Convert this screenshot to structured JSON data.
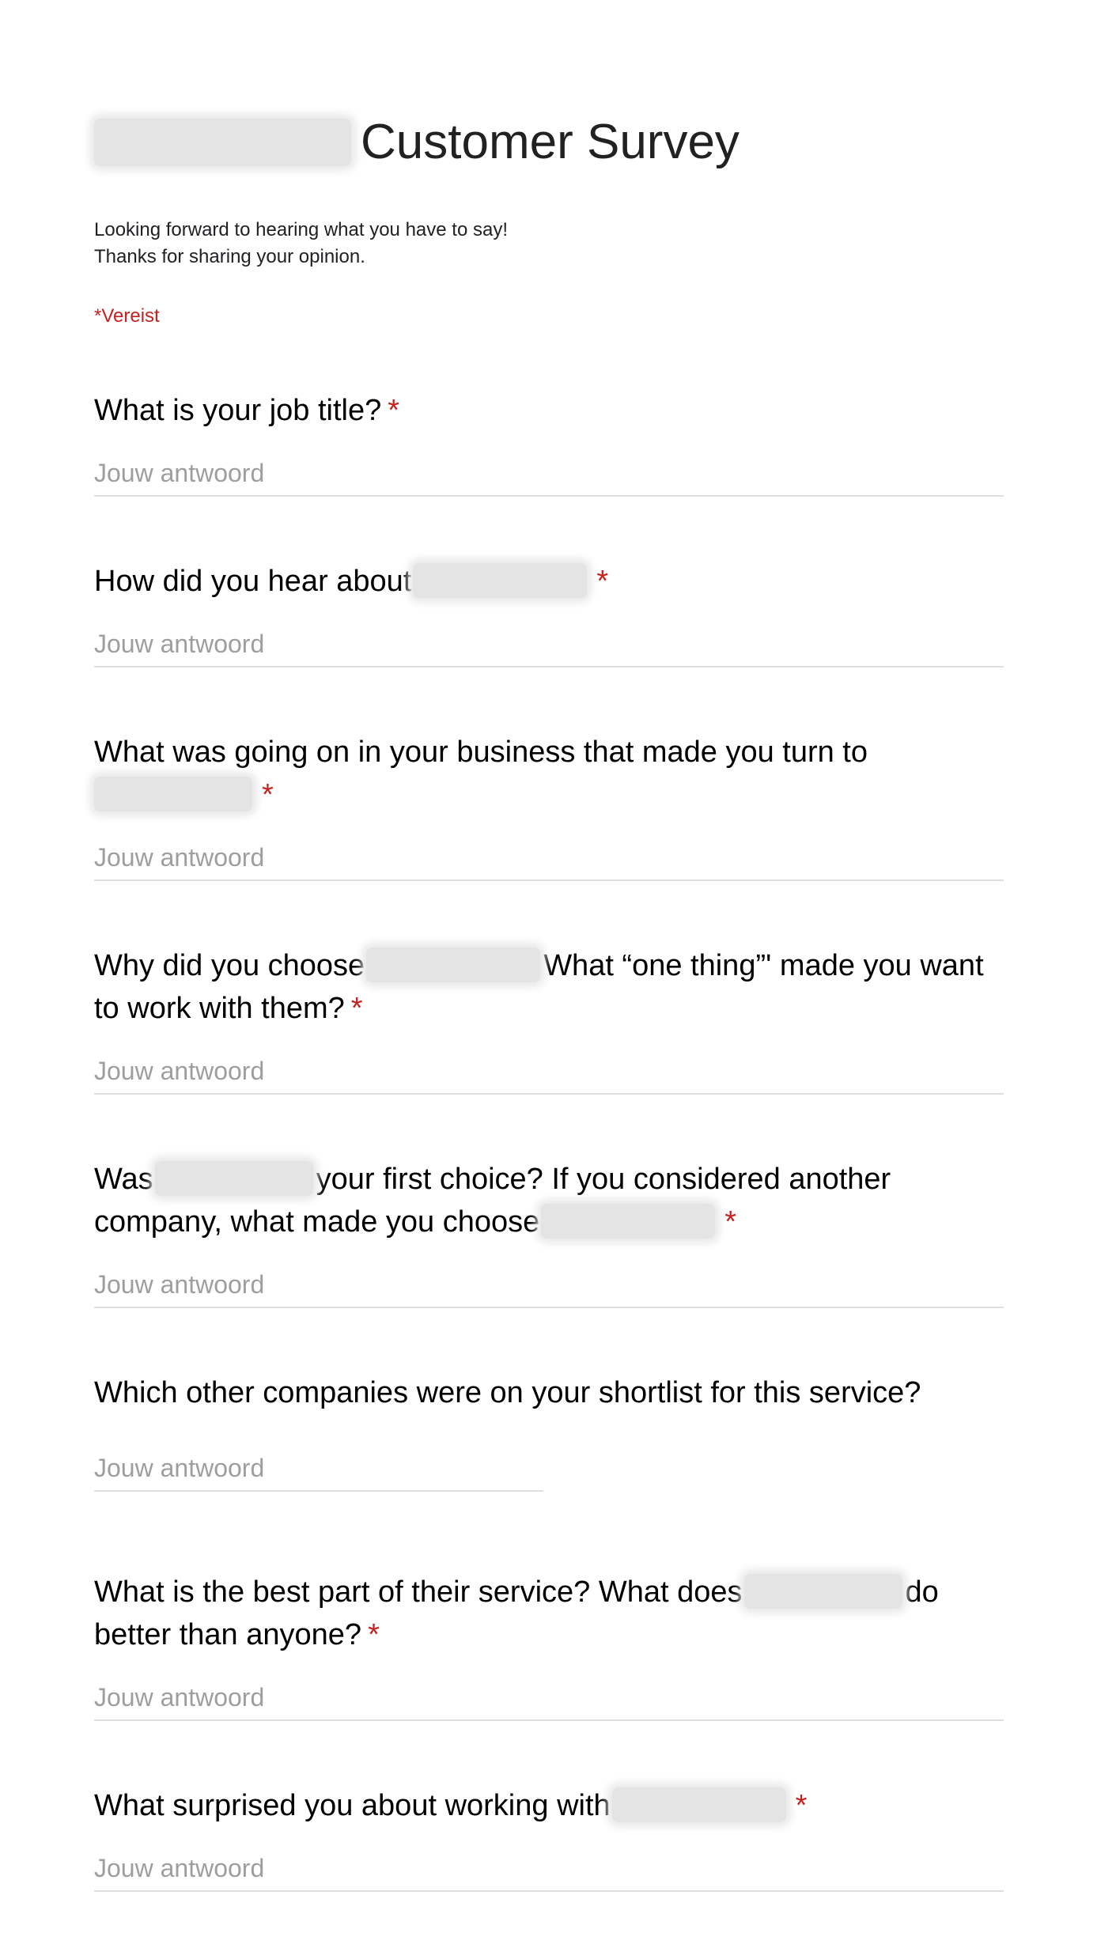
{
  "form": {
    "title": "Customer Survey",
    "description": [
      "Looking forward to hearing what you have to say!",
      "Thanks for sharing your opinion."
    ],
    "required_note": "*Vereist",
    "placeholder": "Jouw antwoord",
    "required_star": "*"
  },
  "questions": [
    {
      "parts": [
        "What is your job title?"
      ],
      "required": true
    },
    {
      "parts": [
        "How did you hear about",
        ""
      ],
      "required": true
    },
    {
      "parts": [
        "What was going on in your business that made you turn to",
        ""
      ],
      "required": true
    },
    {
      "parts": [
        "Why did you choose",
        "What “one thing”' made you want to work with them?"
      ],
      "required": true
    },
    {
      "parts": [
        "Was",
        "your first choice? If you considered another company, what made you choose",
        ""
      ],
      "required": true
    },
    {
      "parts": [
        "Which other companies were on your shortlist for this service?"
      ],
      "required": false
    },
    {
      "parts": [
        "What is the best part of their service? What does",
        "do better than anyone?"
      ],
      "required": true
    },
    {
      "parts": [
        "What surprised you about working with",
        ""
      ],
      "required": true
    }
  ]
}
